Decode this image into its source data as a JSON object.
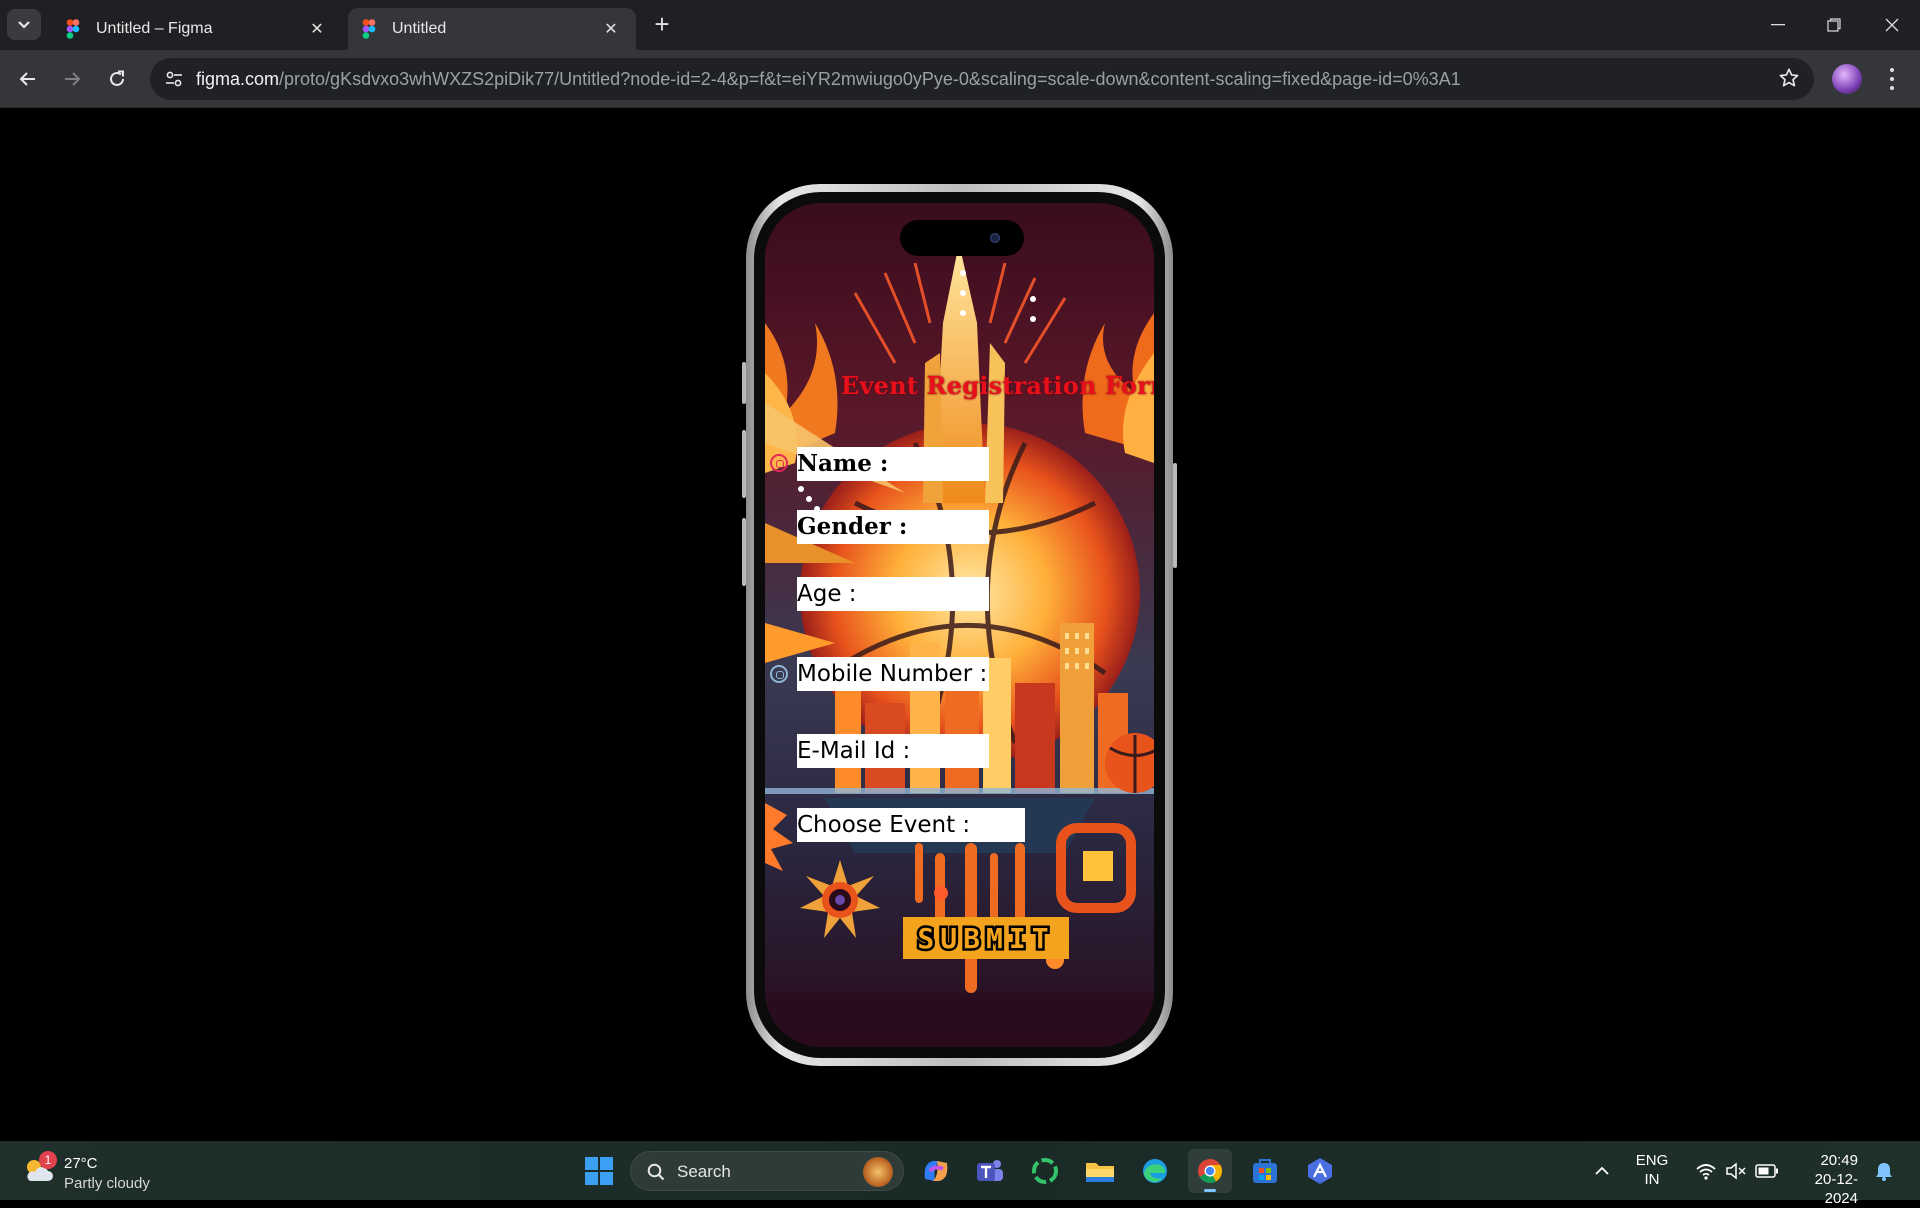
{
  "browser": {
    "tabs": [
      {
        "title": "Untitled – Figma",
        "active": false
      },
      {
        "title": "Untitled",
        "active": true
      }
    ],
    "url_host": "figma.com",
    "url_path": "/proto/gKsdvxo3whWXZS2piDik77/Untitled?node-id=2-4&p=f&t=eiYR2mwiugo0yPye-0&scaling=scale-down&content-scaling=fixed&page-id=0%3A1"
  },
  "form": {
    "title": "Event Registration Form",
    "fields": {
      "name": "Name :",
      "gender": "Gender :",
      "age": "Age :",
      "mobile": "Mobile Number :",
      "email": "E-Mail Id :",
      "event": "Choose Event :"
    },
    "submit_label": "SUBMIT"
  },
  "colors": {
    "title_red": "#e8101b",
    "submit_orange": "#f3a31c",
    "radio_red": "#e0285a",
    "radio_blue": "#8fb6d6"
  },
  "taskbar": {
    "weather": {
      "temp": "27°C",
      "condition": "Partly cloudy",
      "badge": "1"
    },
    "search_label": "Search",
    "apps": [
      "start-icon",
      "copilot-icon",
      "teams-icon",
      "chat-app-icon",
      "file-explorer-icon",
      "edge-icon",
      "chrome-icon",
      "store-icon",
      "aura-app-icon"
    ],
    "lang_line1": "ENG",
    "lang_line2": "IN",
    "time": "20:49",
    "date": "20-12-2024"
  }
}
